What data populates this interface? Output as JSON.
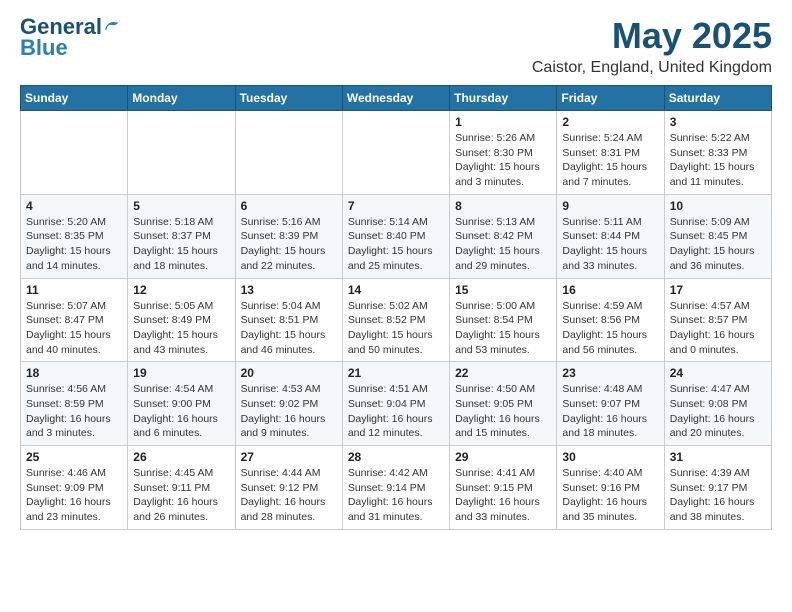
{
  "header": {
    "logo_line1": "General",
    "logo_line2": "Blue",
    "title": "May 2025",
    "subtitle": "Caistor, England, United Kingdom"
  },
  "calendar": {
    "days_of_week": [
      "Sunday",
      "Monday",
      "Tuesday",
      "Wednesday",
      "Thursday",
      "Friday",
      "Saturday"
    ],
    "weeks": [
      [
        {
          "day": "",
          "info": ""
        },
        {
          "day": "",
          "info": ""
        },
        {
          "day": "",
          "info": ""
        },
        {
          "day": "",
          "info": ""
        },
        {
          "day": "1",
          "info": "Sunrise: 5:26 AM\nSunset: 8:30 PM\nDaylight: 15 hours\nand 3 minutes."
        },
        {
          "day": "2",
          "info": "Sunrise: 5:24 AM\nSunset: 8:31 PM\nDaylight: 15 hours\nand 7 minutes."
        },
        {
          "day": "3",
          "info": "Sunrise: 5:22 AM\nSunset: 8:33 PM\nDaylight: 15 hours\nand 11 minutes."
        }
      ],
      [
        {
          "day": "4",
          "info": "Sunrise: 5:20 AM\nSunset: 8:35 PM\nDaylight: 15 hours\nand 14 minutes."
        },
        {
          "day": "5",
          "info": "Sunrise: 5:18 AM\nSunset: 8:37 PM\nDaylight: 15 hours\nand 18 minutes."
        },
        {
          "day": "6",
          "info": "Sunrise: 5:16 AM\nSunset: 8:39 PM\nDaylight: 15 hours\nand 22 minutes."
        },
        {
          "day": "7",
          "info": "Sunrise: 5:14 AM\nSunset: 8:40 PM\nDaylight: 15 hours\nand 25 minutes."
        },
        {
          "day": "8",
          "info": "Sunrise: 5:13 AM\nSunset: 8:42 PM\nDaylight: 15 hours\nand 29 minutes."
        },
        {
          "day": "9",
          "info": "Sunrise: 5:11 AM\nSunset: 8:44 PM\nDaylight: 15 hours\nand 33 minutes."
        },
        {
          "day": "10",
          "info": "Sunrise: 5:09 AM\nSunset: 8:45 PM\nDaylight: 15 hours\nand 36 minutes."
        }
      ],
      [
        {
          "day": "11",
          "info": "Sunrise: 5:07 AM\nSunset: 8:47 PM\nDaylight: 15 hours\nand 40 minutes."
        },
        {
          "day": "12",
          "info": "Sunrise: 5:05 AM\nSunset: 8:49 PM\nDaylight: 15 hours\nand 43 minutes."
        },
        {
          "day": "13",
          "info": "Sunrise: 5:04 AM\nSunset: 8:51 PM\nDaylight: 15 hours\nand 46 minutes."
        },
        {
          "day": "14",
          "info": "Sunrise: 5:02 AM\nSunset: 8:52 PM\nDaylight: 15 hours\nand 50 minutes."
        },
        {
          "day": "15",
          "info": "Sunrise: 5:00 AM\nSunset: 8:54 PM\nDaylight: 15 hours\nand 53 minutes."
        },
        {
          "day": "16",
          "info": "Sunrise: 4:59 AM\nSunset: 8:56 PM\nDaylight: 15 hours\nand 56 minutes."
        },
        {
          "day": "17",
          "info": "Sunrise: 4:57 AM\nSunset: 8:57 PM\nDaylight: 16 hours\nand 0 minutes."
        }
      ],
      [
        {
          "day": "18",
          "info": "Sunrise: 4:56 AM\nSunset: 8:59 PM\nDaylight: 16 hours\nand 3 minutes."
        },
        {
          "day": "19",
          "info": "Sunrise: 4:54 AM\nSunset: 9:00 PM\nDaylight: 16 hours\nand 6 minutes."
        },
        {
          "day": "20",
          "info": "Sunrise: 4:53 AM\nSunset: 9:02 PM\nDaylight: 16 hours\nand 9 minutes."
        },
        {
          "day": "21",
          "info": "Sunrise: 4:51 AM\nSunset: 9:04 PM\nDaylight: 16 hours\nand 12 minutes."
        },
        {
          "day": "22",
          "info": "Sunrise: 4:50 AM\nSunset: 9:05 PM\nDaylight: 16 hours\nand 15 minutes."
        },
        {
          "day": "23",
          "info": "Sunrise: 4:48 AM\nSunset: 9:07 PM\nDaylight: 16 hours\nand 18 minutes."
        },
        {
          "day": "24",
          "info": "Sunrise: 4:47 AM\nSunset: 9:08 PM\nDaylight: 16 hours\nand 20 minutes."
        }
      ],
      [
        {
          "day": "25",
          "info": "Sunrise: 4:46 AM\nSunset: 9:09 PM\nDaylight: 16 hours\nand 23 minutes."
        },
        {
          "day": "26",
          "info": "Sunrise: 4:45 AM\nSunset: 9:11 PM\nDaylight: 16 hours\nand 26 minutes."
        },
        {
          "day": "27",
          "info": "Sunrise: 4:44 AM\nSunset: 9:12 PM\nDaylight: 16 hours\nand 28 minutes."
        },
        {
          "day": "28",
          "info": "Sunrise: 4:42 AM\nSunset: 9:14 PM\nDaylight: 16 hours\nand 31 minutes."
        },
        {
          "day": "29",
          "info": "Sunrise: 4:41 AM\nSunset: 9:15 PM\nDaylight: 16 hours\nand 33 minutes."
        },
        {
          "day": "30",
          "info": "Sunrise: 4:40 AM\nSunset: 9:16 PM\nDaylight: 16 hours\nand 35 minutes."
        },
        {
          "day": "31",
          "info": "Sunrise: 4:39 AM\nSunset: 9:17 PM\nDaylight: 16 hours\nand 38 minutes."
        }
      ]
    ]
  }
}
